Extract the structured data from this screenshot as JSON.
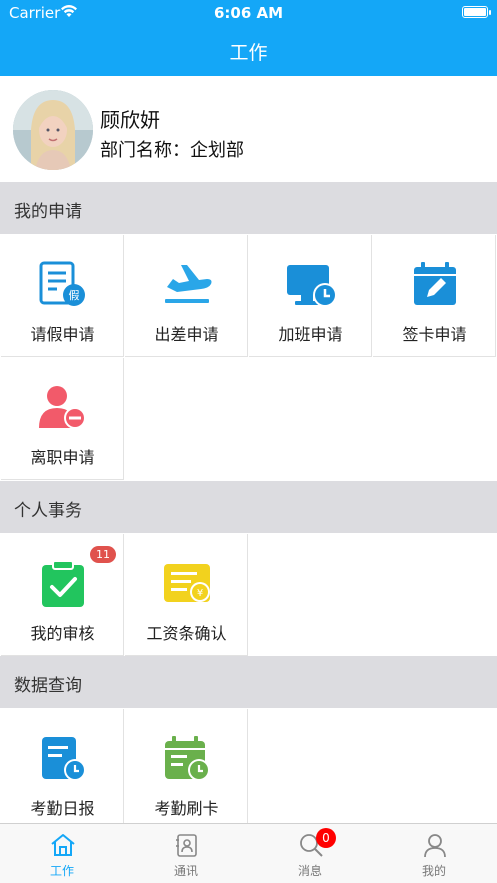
{
  "status_bar": {
    "carrier": "Carrier",
    "time": "6:06 AM",
    "wifi_icon": "wifi-icon",
    "battery_icon": "battery-icon"
  },
  "nav": {
    "title": "工作"
  },
  "profile": {
    "name": "顾欣妍",
    "dept_label": "部门名称：",
    "dept_value": "企划部"
  },
  "sections": {
    "my_applications": {
      "title": "我的申请",
      "items": [
        {
          "label": "请假申请",
          "icon": "leave-form-icon",
          "color": "#1a8fd8"
        },
        {
          "label": "出差申请",
          "icon": "airplane-icon",
          "color": "#2aa6e8"
        },
        {
          "label": "加班申请",
          "icon": "monitor-clock-icon",
          "color": "#1a8fd8"
        },
        {
          "label": "签卡申请",
          "icon": "calendar-edit-icon",
          "color": "#1a8fd8"
        },
        {
          "label": "离职申请",
          "icon": "user-remove-icon",
          "color": "#f25a6a"
        }
      ]
    },
    "personal_affairs": {
      "title": "个人事务",
      "items": [
        {
          "label": "我的审核",
          "icon": "clipboard-check-icon",
          "color": "#22c55e",
          "badge": "11"
        },
        {
          "label": "工资条确认",
          "icon": "salary-slip-icon",
          "color": "#f2d21e"
        }
      ]
    },
    "data_query": {
      "title": "数据查询",
      "items": [
        {
          "label": "考勤日报",
          "icon": "report-clock-icon",
          "color": "#1a8fd8"
        },
        {
          "label": "考勤刷卡",
          "icon": "calendar-clock-icon",
          "color": "#6ab04c"
        }
      ]
    }
  },
  "tab_bar": {
    "items": [
      {
        "label": "工作",
        "icon": "home-icon",
        "active": true
      },
      {
        "label": "通讯",
        "icon": "contacts-icon",
        "active": false
      },
      {
        "label": "消息",
        "icon": "message-search-icon",
        "active": false,
        "badge": "0"
      },
      {
        "label": "我的",
        "icon": "person-icon",
        "active": false
      }
    ]
  },
  "colors": {
    "primary": "#14a7f7",
    "section_bg": "#dcdce0",
    "badge_red": "#e0524d",
    "tab_badge_red": "#ff0000"
  }
}
